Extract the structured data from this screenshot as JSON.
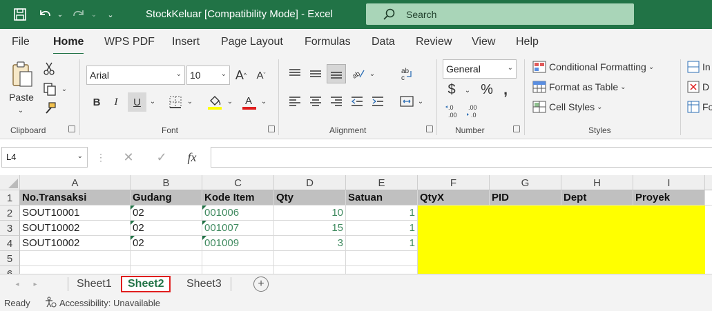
{
  "window": {
    "title": "StockKeluar  [Compatibility Mode]  -  Excel",
    "search_placeholder": "Search"
  },
  "menu": [
    "File",
    "Home",
    "WPS PDF",
    "Insert",
    "Page Layout",
    "Formulas",
    "Data",
    "Review",
    "View",
    "Help"
  ],
  "ribbon": {
    "clipboard": {
      "paste_label": "Paste",
      "group_label": "Clipboard"
    },
    "font": {
      "font_name": "Arial",
      "font_size": "10",
      "bold": "B",
      "italic": "I",
      "underline": "U",
      "group_label": "Font"
    },
    "alignment": {
      "group_label": "Alignment"
    },
    "number": {
      "format": "General",
      "currency": "$",
      "percent": "%",
      "comma": ",",
      "inc_decimal": "←.0\n.00",
      "dec_decimal": ".00\n→.0",
      "group_label": "Number"
    },
    "styles": {
      "conditional": "Conditional Formatting",
      "format_table": "Format as Table",
      "cell_styles": "Cell Styles",
      "group_label": "Styles"
    },
    "cells": {
      "insert": "In",
      "delete": "D",
      "format": "Fo"
    }
  },
  "formula_bar": {
    "name_box": "L4",
    "fx": "fx",
    "value": ""
  },
  "grid": {
    "columns": [
      "A",
      "B",
      "C",
      "D",
      "E",
      "F",
      "G",
      "H",
      "I"
    ],
    "rows": [
      "1",
      "2",
      "3",
      "4",
      "5",
      "6"
    ],
    "header_row": [
      "No.Transaksi",
      "Gudang",
      "Kode Item",
      "Qty",
      "Satuan",
      "QtyX",
      "PID",
      "Dept",
      "Proyek"
    ],
    "data": [
      [
        "SOUT10001",
        "02",
        "001006",
        "10",
        "1"
      ],
      [
        "SOUT10002",
        "02",
        "001007",
        "15",
        "1"
      ],
      [
        "SOUT10002",
        "02",
        "001009",
        "3",
        "1"
      ]
    ]
  },
  "sheets": [
    "Sheet1",
    "Sheet2",
    "Sheet3"
  ],
  "active_sheet": "Sheet2",
  "status": {
    "ready": "Ready",
    "accessibility": "Accessibility: Unavailable"
  },
  "colors": {
    "brand": "#217346",
    "highlight": "#ffff00",
    "header_fill": "#c0c0c0",
    "active_tab_border": "#e01e1e"
  }
}
